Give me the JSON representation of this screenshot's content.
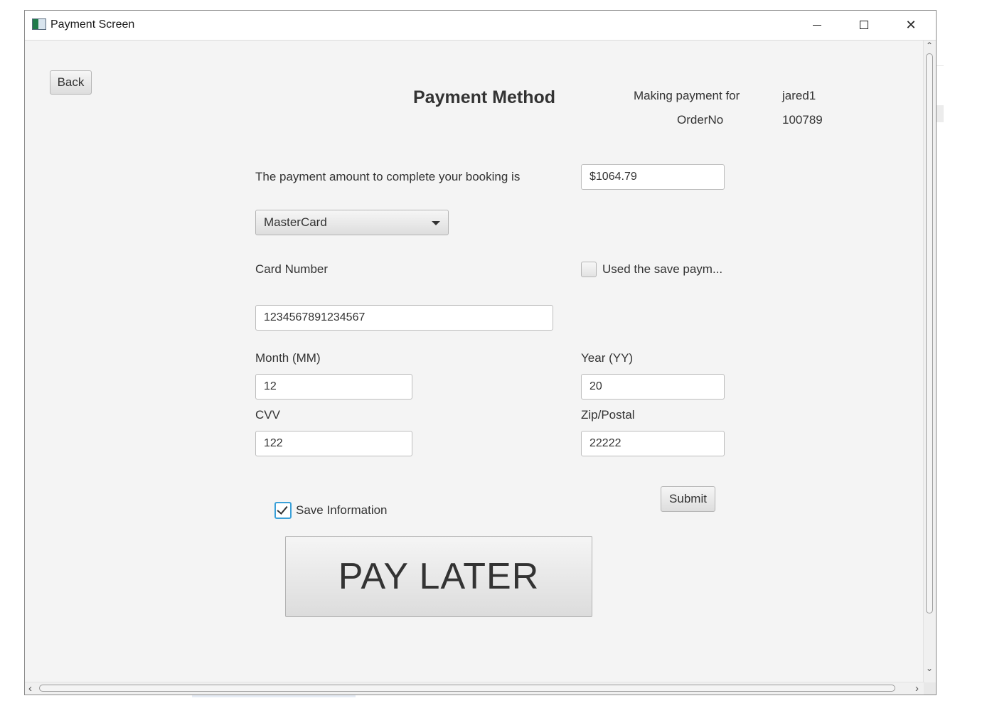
{
  "window": {
    "title": "Payment Screen",
    "controls": {
      "minimize_icon": "minimize-icon",
      "maximize_icon": "maximize-icon",
      "close_glyph": "✕"
    }
  },
  "header": {
    "back_label": "Back",
    "title": "Payment Method",
    "making_payment_label": "Making payment for",
    "making_payment_value": "jared1",
    "order_label": "OrderNo",
    "order_value": "100789"
  },
  "form": {
    "amount_label": "The payment amount to complete your booking is",
    "amount_value": "$1064.79",
    "card_type_selected": "MasterCard",
    "card_number_label": "Card Number",
    "use_saved_label": "Used the save paym...",
    "use_saved_checked": false,
    "card_number_value": "1234567891234567",
    "month_label": "Month (MM)",
    "month_value": "12",
    "year_label": "Year (YY)",
    "year_value": "20",
    "cvv_label": "CVV",
    "cvv_value": "122",
    "zip_label": "Zip/Postal",
    "zip_value": "22222",
    "submit_label": "Submit",
    "save_info_label": "Save Information",
    "save_info_checked": true,
    "pay_later_label": "PAY LATER"
  },
  "scrollbars": {
    "up_arrow": "⌃",
    "down_arrow": "⌄",
    "left_arrow": "‹",
    "right_arrow": "›"
  },
  "colors": {
    "window_bg": "#f4f4f4",
    "focus_accent": "#3aa0d8",
    "text": "#333333"
  }
}
